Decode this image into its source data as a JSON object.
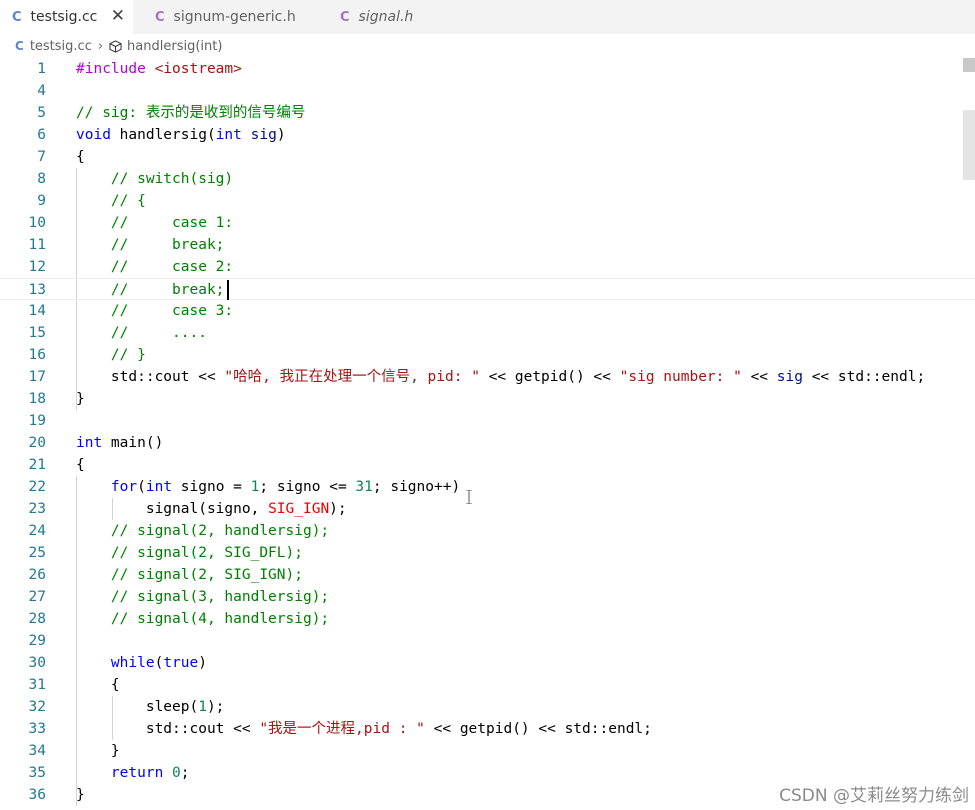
{
  "tabs": [
    {
      "icon": "C",
      "label": "testsig.cc",
      "close": "✕"
    },
    {
      "icon": "C",
      "label": "signum-generic.h"
    },
    {
      "icon": "C",
      "label": "signal.h"
    }
  ],
  "breadcrumb": {
    "file": "testsig.cc",
    "symbol": "handlersig(int)"
  },
  "colors": {
    "keyword": "#0000ff",
    "comment": "#008000",
    "string": "#a31515",
    "number": "#098658",
    "macro": "#ee0000",
    "type": "#267f99",
    "param": "#001080",
    "preproc": "#af00db",
    "line_number": "#237893"
  },
  "lines": [
    {
      "n": "1",
      "segs": [
        {
          "t": "#include ",
          "c": "plain"
        },
        {
          "t": "<iostream>",
          "c": "string"
        }
      ]
    },
    {
      "n": "4",
      "segs": []
    },
    {
      "n": "5",
      "segs": [
        {
          "t": "// sig: 表示的是收到的信号编号",
          "c": "comment"
        }
      ]
    },
    {
      "n": "6",
      "segs": [
        {
          "t": "void",
          "c": "keyword"
        },
        {
          "t": " handlersig(",
          "c": "plain"
        },
        {
          "t": "int",
          "c": "keyword"
        },
        {
          "t": " ",
          "c": "plain"
        },
        {
          "t": "sig",
          "c": "param"
        },
        {
          "t": ")",
          "c": "plain"
        }
      ]
    },
    {
      "n": "7",
      "segs": [
        {
          "t": "{",
          "c": "plain"
        }
      ]
    },
    {
      "n": "8",
      "segs": [
        {
          "t": "    // switch(sig)",
          "c": "comment"
        }
      ]
    },
    {
      "n": "9",
      "segs": [
        {
          "t": "    // {",
          "c": "comment"
        }
      ]
    },
    {
      "n": "10",
      "segs": [
        {
          "t": "    //     case 1:",
          "c": "comment"
        }
      ]
    },
    {
      "n": "11",
      "segs": [
        {
          "t": "    //     break;",
          "c": "comment"
        }
      ]
    },
    {
      "n": "12",
      "segs": [
        {
          "t": "    //     case 2:",
          "c": "comment"
        }
      ]
    },
    {
      "n": "13",
      "segs": [
        {
          "t": "    //     break;",
          "c": "comment"
        }
      ]
    },
    {
      "n": "14",
      "segs": [
        {
          "t": "    //     case 3:",
          "c": "comment"
        }
      ]
    },
    {
      "n": "15",
      "segs": [
        {
          "t": "    //     ....",
          "c": "comment"
        }
      ]
    },
    {
      "n": "16",
      "segs": [
        {
          "t": "    // }",
          "c": "comment"
        }
      ]
    },
    {
      "n": "17",
      "segs": [
        {
          "t": "    std::cout << ",
          "c": "plain"
        },
        {
          "t": "\"哈哈, 我正在处理一个信号, pid: \"",
          "c": "string"
        },
        {
          "t": " << getpid() << ",
          "c": "plain"
        },
        {
          "t": "\"sig number: \"",
          "c": "string"
        },
        {
          "t": " << ",
          "c": "plain"
        },
        {
          "t": "sig",
          "c": "param"
        },
        {
          "t": " << std::endl;",
          "c": "plain"
        }
      ]
    },
    {
      "n": "18",
      "segs": [
        {
          "t": "}",
          "c": "plain"
        }
      ]
    },
    {
      "n": "19",
      "segs": []
    },
    {
      "n": "20",
      "segs": [
        {
          "t": "int",
          "c": "keyword"
        },
        {
          "t": " main()",
          "c": "plain"
        }
      ]
    },
    {
      "n": "21",
      "segs": [
        {
          "t": "{",
          "c": "plain"
        }
      ]
    },
    {
      "n": "22",
      "segs": [
        {
          "t": "    ",
          "c": "plain"
        },
        {
          "t": "for",
          "c": "keyword"
        },
        {
          "t": "(",
          "c": "plain"
        },
        {
          "t": "int",
          "c": "keyword"
        },
        {
          "t": " signo = ",
          "c": "plain"
        },
        {
          "t": "1",
          "c": "number"
        },
        {
          "t": "; signo <= ",
          "c": "plain"
        },
        {
          "t": "31",
          "c": "number"
        },
        {
          "t": "; signo++)",
          "c": "plain"
        }
      ]
    },
    {
      "n": "23",
      "segs": [
        {
          "t": "        signal(signo, ",
          "c": "plain"
        },
        {
          "t": "SIG_IGN",
          "c": "macro"
        },
        {
          "t": ");",
          "c": "plain"
        }
      ]
    },
    {
      "n": "24",
      "segs": [
        {
          "t": "    // signal(2, handlersig);",
          "c": "comment"
        }
      ]
    },
    {
      "n": "25",
      "segs": [
        {
          "t": "    // signal(2, SIG_DFL);",
          "c": "comment"
        }
      ]
    },
    {
      "n": "26",
      "segs": [
        {
          "t": "    // signal(2, SIG_IGN);",
          "c": "comment"
        }
      ]
    },
    {
      "n": "27",
      "segs": [
        {
          "t": "    // signal(3, handlersig);",
          "c": "comment"
        }
      ]
    },
    {
      "n": "28",
      "segs": [
        {
          "t": "    // signal(4, handlersig);",
          "c": "comment"
        }
      ]
    },
    {
      "n": "29",
      "segs": []
    },
    {
      "n": "30",
      "segs": [
        {
          "t": "    ",
          "c": "plain"
        },
        {
          "t": "while",
          "c": "keyword"
        },
        {
          "t": "(",
          "c": "plain"
        },
        {
          "t": "true",
          "c": "keyword"
        },
        {
          "t": ")",
          "c": "plain"
        }
      ]
    },
    {
      "n": "31",
      "segs": [
        {
          "t": "    {",
          "c": "plain"
        }
      ]
    },
    {
      "n": "32",
      "segs": [
        {
          "t": "        sleep(",
          "c": "plain"
        },
        {
          "t": "1",
          "c": "number"
        },
        {
          "t": ");",
          "c": "plain"
        }
      ]
    },
    {
      "n": "33",
      "segs": [
        {
          "t": "        std::cout << ",
          "c": "plain"
        },
        {
          "t": "\"我是一个进程,pid : \"",
          "c": "string"
        },
        {
          "t": " << getpid() << std::endl;",
          "c": "plain"
        }
      ]
    },
    {
      "n": "34",
      "segs": [
        {
          "t": "    }",
          "c": "plain"
        }
      ]
    },
    {
      "n": "35",
      "segs": [
        {
          "t": "    ",
          "c": "plain"
        },
        {
          "t": "return",
          "c": "keyword"
        },
        {
          "t": " ",
          "c": "plain"
        },
        {
          "t": "0",
          "c": "number"
        },
        {
          "t": ";",
          "c": "plain"
        }
      ]
    },
    {
      "n": "36",
      "segs": [
        {
          "t": "}",
          "c": "plain"
        }
      ]
    }
  ],
  "watermark": "CSDN @艾莉丝努力练剑"
}
